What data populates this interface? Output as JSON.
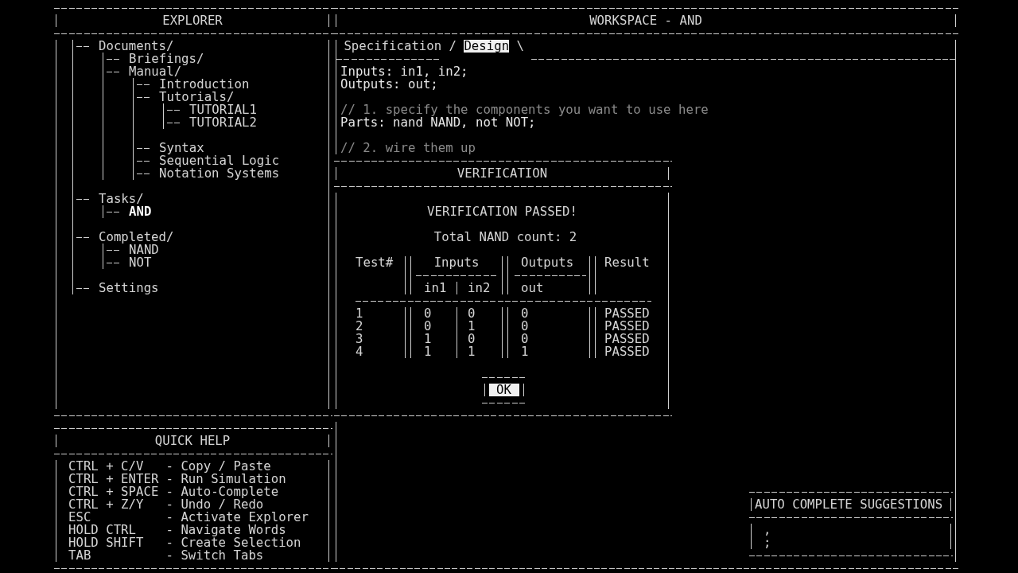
{
  "explorer": {
    "title": "EXPLORER",
    "tree": [
      {
        "label": "Documents/",
        "selected": false,
        "children": [
          {
            "label": "Briefings/",
            "selected": false
          },
          {
            "label": "Manual/",
            "selected": false,
            "children": [
              {
                "label": "Introduction",
                "selected": false
              },
              {
                "label": "Tutorials/",
                "selected": false,
                "children": [
                  {
                    "label": "TUTORIAL1",
                    "selected": false
                  },
                  {
                    "label": "TUTORIAL2",
                    "selected": false
                  }
                ]
              },
              {
                "label": "Syntax",
                "selected": false
              },
              {
                "label": "Sequential Logic",
                "selected": false
              },
              {
                "label": "Notation Systems",
                "selected": false
              }
            ]
          }
        ]
      },
      {
        "label": "Tasks/",
        "selected": false,
        "children": [
          {
            "label": "AND",
            "selected": true
          }
        ]
      },
      {
        "label": "Completed/",
        "selected": false,
        "children": [
          {
            "label": "NAND",
            "selected": false
          },
          {
            "label": "NOT",
            "selected": false
          }
        ]
      },
      {
        "label": "Settings",
        "selected": false
      }
    ]
  },
  "quick_help": {
    "title": "QUICK HELP",
    "items": [
      {
        "keys": "CTRL + C/V",
        "action": "- Copy / Paste"
      },
      {
        "keys": "CTRL + ENTER",
        "action": "- Run Simulation"
      },
      {
        "keys": "CTRL + SPACE",
        "action": "- Auto-Complete"
      },
      {
        "keys": "CTRL + Z/Y",
        "action": "- Undo / Redo"
      },
      {
        "keys": "ESC",
        "action": "- Activate Explorer"
      },
      {
        "keys": "HOLD CTRL",
        "action": "- Navigate Words"
      },
      {
        "keys": "HOLD SHIFT",
        "action": "- Create Selection"
      },
      {
        "keys": "TAB",
        "action": "- Switch Tabs"
      }
    ]
  },
  "workspace": {
    "title": "WORKSPACE - AND",
    "tab_divider": "/",
    "tab_end": "\\",
    "tabs": [
      {
        "label": "Specification",
        "selected": false
      },
      {
        "label": "Design",
        "selected": true
      }
    ],
    "editor": {
      "blocks": [
        [
          {
            "kind": "code",
            "text": "Inputs: in1, in2;"
          },
          {
            "kind": "code",
            "text": "Outputs: out;"
          }
        ],
        [
          {
            "kind": "comment",
            "text": "// 1. specify the components you want to use here"
          },
          {
            "kind": "code",
            "text": "Parts: nand NAND, not NOT;"
          }
        ],
        [
          {
            "kind": "comment",
            "text": "// 2. wire them up"
          }
        ]
      ]
    }
  },
  "verification_dialog": {
    "title": "VERIFICATION",
    "message": "VERIFICATION PASSED!",
    "nand_count": "Total NAND count: 2",
    "table": {
      "columns": [
        "Test#",
        "Inputs",
        "Outputs",
        "Result"
      ],
      "input_names": [
        "in1",
        "in2"
      ],
      "output_names": [
        "out"
      ],
      "rows": [
        {
          "test": "1",
          "inputs": [
            "0",
            "0"
          ],
          "outputs": [
            "0"
          ],
          "result": "PASSED"
        },
        {
          "test": "2",
          "inputs": [
            "0",
            "1"
          ],
          "outputs": [
            "0"
          ],
          "result": "PASSED"
        },
        {
          "test": "3",
          "inputs": [
            "1",
            "0"
          ],
          "outputs": [
            "0"
          ],
          "result": "PASSED"
        },
        {
          "test": "4",
          "inputs": [
            "1",
            "1"
          ],
          "outputs": [
            "1"
          ],
          "result": "PASSED"
        }
      ]
    },
    "button": "OK"
  },
  "autocomplete": {
    "title": "AUTO COMPLETE SUGGESTIONS",
    "items": [
      ",",
      ";"
    ]
  }
}
